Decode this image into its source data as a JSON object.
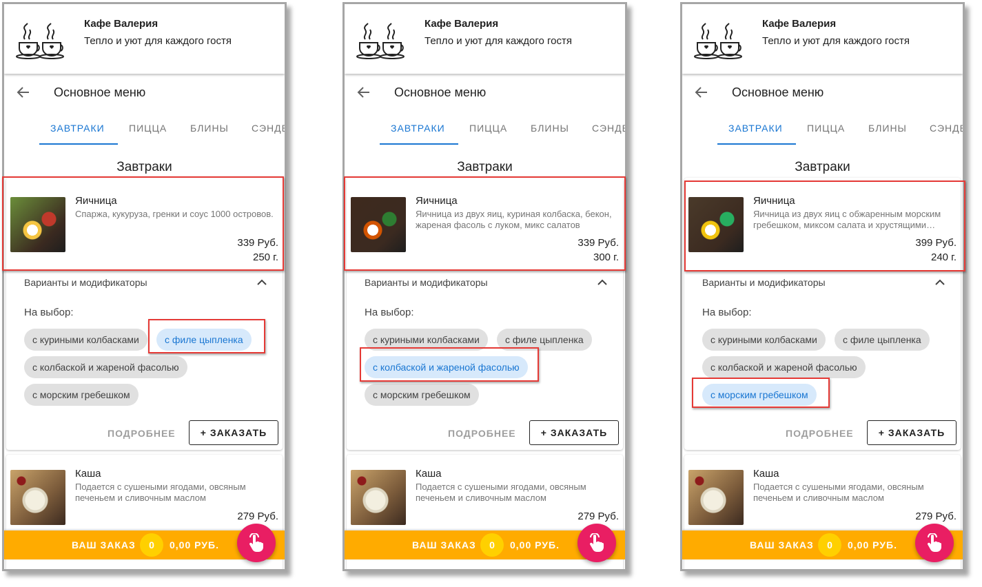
{
  "panels": [
    {
      "header": {
        "cafe_name": "Кафе Валерия",
        "slogan": "Тепло и уют для каждого гостя"
      },
      "nav": {
        "title": "Основное меню"
      },
      "tabs": [
        "ЗАВТРАКИ",
        "ПИЦЦА",
        "БЛИНЫ",
        "СЭНДВИЧИ"
      ],
      "active_tab": "ЗАВТРАКИ",
      "section_title": "Завтраки",
      "item": {
        "name": "Яичница",
        "desc": "Спаржа, кукуруза, гренки и соус 1000 островов.",
        "price": "339 Руб.",
        "weight": "250 г."
      },
      "variants": {
        "header": "Варианты и модификаторы",
        "choice_label": "На выбор:",
        "chips": [
          "с куриными колбасками",
          "с филе цыпленка",
          "с колбаской и жареной фасолью",
          "с морским гребешком"
        ],
        "selected": "с филе цыпленка"
      },
      "buttons": {
        "more": "ПОДРОБНЕЕ",
        "order": "+ ЗАКАЗАТЬ"
      },
      "item2": {
        "name": "Каша",
        "desc": "Подается с сушеными ягодами, овсяным печеньем и сливочным маслом",
        "price": "279 Руб."
      },
      "order_bar": {
        "label": "ВАШ ЗАКАЗ",
        "count": "0",
        "sum": "0,00 РУБ."
      }
    },
    {
      "header": {
        "cafe_name": "Кафе Валерия",
        "slogan": "Тепло и уют для каждого гостя"
      },
      "nav": {
        "title": "Основное меню"
      },
      "tabs": [
        "ЗАВТРАКИ",
        "ПИЦЦА",
        "БЛИНЫ",
        "СЭНДВИЧИ"
      ],
      "active_tab": "ЗАВТРАКИ",
      "section_title": "Завтраки",
      "item": {
        "name": "Яичница",
        "desc": "Яичница из двух яиц, куриная колбаска, бекон, жареная фасоль с луком, микс салатов",
        "price": "339 Руб.",
        "weight": "300 г."
      },
      "variants": {
        "header": "Варианты и модификаторы",
        "choice_label": "На выбор:",
        "chips": [
          "с куриными колбасками",
          "с филе цыпленка",
          "с колбаской и жареной фасолью",
          "с морским гребешком"
        ],
        "selected": "с колбаской и жареной фасолью"
      },
      "buttons": {
        "more": "ПОДРОБНЕЕ",
        "order": "+ ЗАКАЗАТЬ"
      },
      "item2": {
        "name": "Каша",
        "desc": "Подается с сушеными ягодами, овсяным печеньем и сливочным маслом",
        "price": "279 Руб."
      },
      "order_bar": {
        "label": "ВАШ ЗАКАЗ",
        "count": "0",
        "sum": "0,00 РУБ."
      }
    },
    {
      "header": {
        "cafe_name": "Кафе Валерия",
        "slogan": "Тепло и уют для каждого гостя"
      },
      "nav": {
        "title": "Основное меню"
      },
      "tabs": [
        "ЗАВТРАКИ",
        "ПИЦЦА",
        "БЛИНЫ",
        "СЭНДВИЧИ"
      ],
      "active_tab": "ЗАВТРАКИ",
      "section_title": "Завтраки",
      "item": {
        "name": "Яичница",
        "desc": "Яичница из двух яиц с обжаренным морским гребешком, миксом салата и хрустящими гренками",
        "price": "399 Руб.",
        "weight": "240 г."
      },
      "variants": {
        "header": "Варианты и модификаторы",
        "choice_label": "На выбор:",
        "chips": [
          "с куриными колбасками",
          "с филе цыпленка",
          "с колбаской и жареной фасолью",
          "с морским гребешком"
        ],
        "selected": "с морским гребешком"
      },
      "buttons": {
        "more": "ПОДРОБНЕЕ",
        "order": "+ ЗАКАЗАТЬ"
      },
      "item2": {
        "name": "Каша",
        "desc": "Подается с сушеными ягодами, овсяным печеньем и сливочным маслом",
        "price": "279 Руб."
      },
      "order_bar": {
        "label": "ВАШ ЗАКАЗ",
        "count": "0",
        "sum": "0,00 РУБ."
      }
    }
  ],
  "colors": {
    "accent": "#1976d2",
    "order_bar": "#ffab00",
    "fab": "#e91e63",
    "highlight": "#e53935",
    "chip_selected": "#d7e9fb"
  },
  "icons": {
    "logo": "coffee-cups-icon",
    "back": "arrow-back-icon",
    "collapse": "chevron-up-icon",
    "fab": "tap-hand-icon"
  }
}
